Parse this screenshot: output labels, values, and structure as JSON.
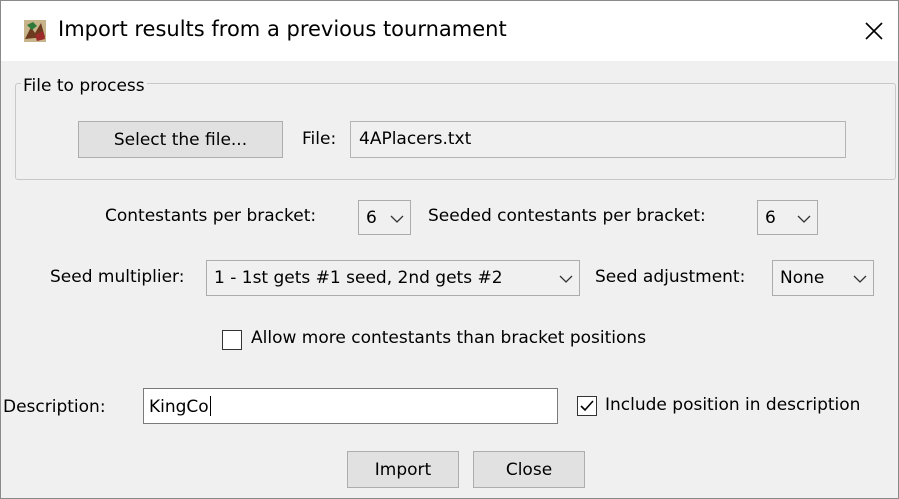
{
  "window": {
    "title": "Import results from a previous tournament",
    "icon": "app-icon",
    "close_icon": "close-icon"
  },
  "file_group": {
    "title": "File to process",
    "select_button": "Select the file...",
    "file_label": "File:",
    "file_value": "4APlacers.txt"
  },
  "options": {
    "contestants_label": "Contestants per bracket:",
    "contestants_value": "6",
    "seeded_label": "Seeded contestants per bracket:",
    "seeded_value": "6",
    "multiplier_label": "Seed multiplier:",
    "multiplier_value": "1 - 1st gets #1 seed, 2nd gets #2",
    "adjustment_label": "Seed adjustment:",
    "adjustment_value": "None",
    "allow_more_label": "Allow more contestants than bracket positions",
    "allow_more_checked": false
  },
  "description": {
    "label": "Description:",
    "value": "KingCo",
    "include_position_label": "Include position in description",
    "include_position_checked": true
  },
  "buttons": {
    "import": "Import",
    "close": "Close"
  }
}
